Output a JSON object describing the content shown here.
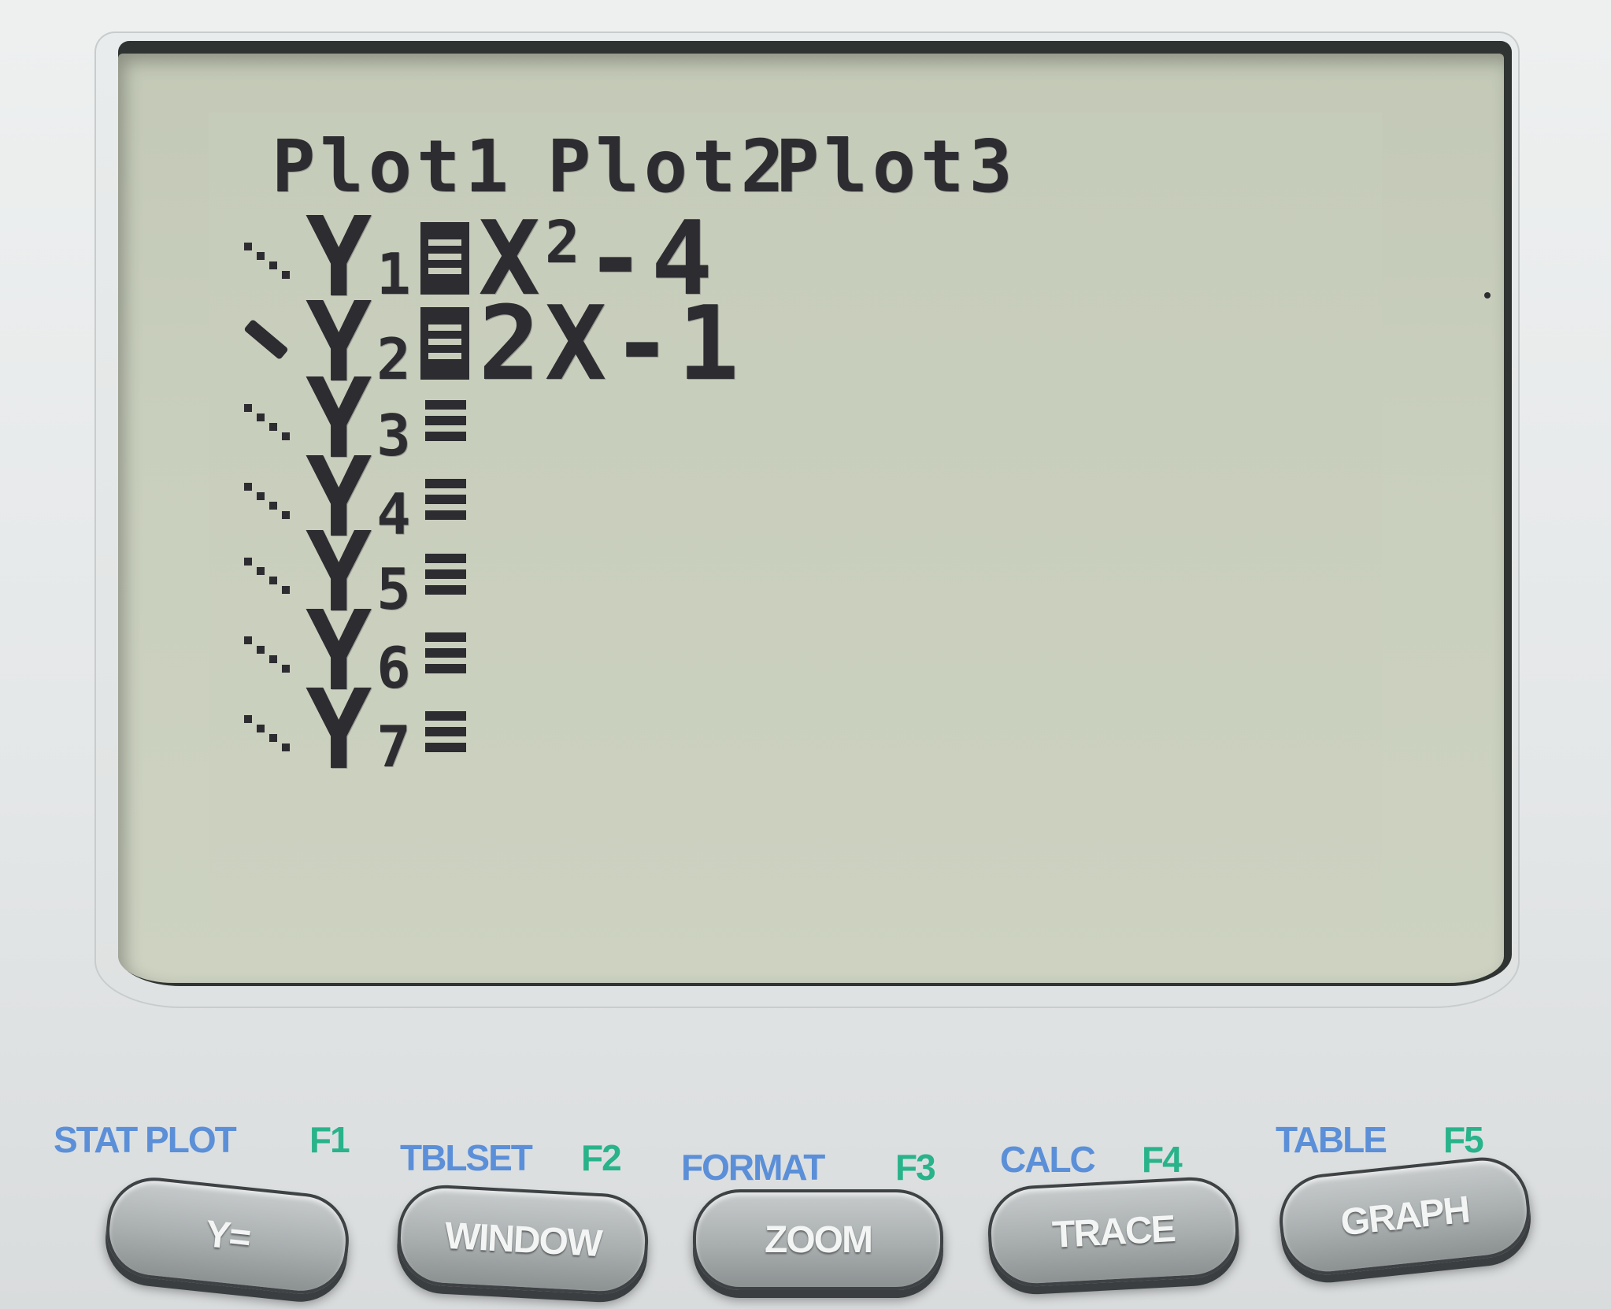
{
  "screen": {
    "plots": [
      "Plot1",
      "Plot2",
      "Plot3"
    ],
    "functions": [
      {
        "name": "Y",
        "index": "1",
        "selected": true,
        "expr_base": "X",
        "expr_exp": "2",
        "expr_rest": "-4",
        "style": "normal"
      },
      {
        "name": "Y",
        "index": "2",
        "selected": true,
        "expr_base": "2X-1",
        "expr_exp": "",
        "expr_rest": "",
        "style": "thick"
      },
      {
        "name": "Y",
        "index": "3",
        "selected": false,
        "expr_base": "",
        "expr_exp": "",
        "expr_rest": "",
        "style": "normal"
      },
      {
        "name": "Y",
        "index": "4",
        "selected": false,
        "expr_base": "",
        "expr_exp": "",
        "expr_rest": "",
        "style": "normal"
      },
      {
        "name": "Y",
        "index": "5",
        "selected": false,
        "expr_base": "",
        "expr_exp": "",
        "expr_rest": "",
        "style": "normal"
      },
      {
        "name": "Y",
        "index": "6",
        "selected": false,
        "expr_base": "",
        "expr_exp": "",
        "expr_rest": "",
        "style": "normal"
      },
      {
        "name": "Y",
        "index": "7",
        "selected": false,
        "expr_base": "",
        "expr_exp": "",
        "expr_rest": "",
        "style": "normal"
      }
    ]
  },
  "keys": [
    {
      "second": "STAT PLOT",
      "alpha": "F1",
      "label": "Y="
    },
    {
      "second": "TBLSET",
      "alpha": "F2",
      "label": "WINDOW"
    },
    {
      "second": "FORMAT",
      "alpha": "F3",
      "label": "ZOOM"
    },
    {
      "second": "CALC",
      "alpha": "F4",
      "label": "TRACE"
    },
    {
      "second": "TABLE",
      "alpha": "F5",
      "label": "GRAPH"
    }
  ],
  "colors": {
    "lcd": "#c8cdbb",
    "pixel": "#2c2c31",
    "second_function": "#5b8fd8",
    "alpha_function": "#29b38a"
  }
}
